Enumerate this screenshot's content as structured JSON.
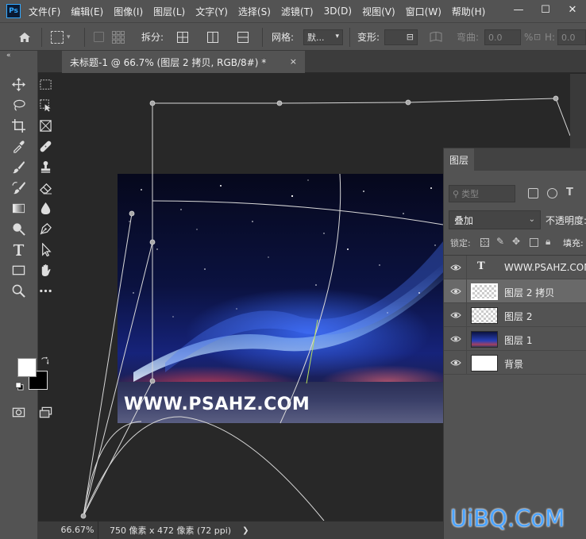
{
  "app": {
    "logo_text": "Ps"
  },
  "menu": {
    "items": [
      "文件(F)",
      "编辑(E)",
      "图像(I)",
      "图层(L)",
      "文字(Y)",
      "选择(S)",
      "滤镜(T)",
      "3D(D)",
      "视图(V)",
      "窗口(W)",
      "帮助(H)"
    ]
  },
  "window_controls": {
    "minimize": "—",
    "maximize": "☐",
    "close": "✕"
  },
  "options_bar": {
    "split_label": "拆分:",
    "grid_label": "网格:",
    "grid_value": "默...",
    "transform_label": "变形:",
    "warp_label": "弯曲:",
    "warp_value": "0.0",
    "percent": "%",
    "h_label": "H:",
    "h_value": "0.0"
  },
  "document": {
    "tab_title": "未标题-1 @ 66.7% (图层 2 拷贝, RGB/8#) *",
    "close": "×",
    "photo_watermark": "WWW.PSAHZ.COM"
  },
  "status": {
    "zoom": "66.67%",
    "info": "750 像素 x 472 像素 (72 ppi)",
    "arrow": "❯"
  },
  "layers_panel": {
    "tab": "图层",
    "search_placeholder": "类型",
    "blend_mode": "叠加",
    "opacity_label": "不透明度:",
    "lock_label": "锁定:",
    "fill_label": "填充:",
    "layers": [
      {
        "name": "WWW.PSAHZ.COM",
        "kind": "type",
        "selected": false
      },
      {
        "name": "图层 2 拷贝",
        "kind": "transparent",
        "selected": true
      },
      {
        "name": "图层 2",
        "kind": "transparent",
        "selected": false
      },
      {
        "name": "图层 1",
        "kind": "photo",
        "selected": false
      },
      {
        "name": "背景",
        "kind": "white",
        "selected": false
      }
    ],
    "type_thumb_glyph": "T"
  },
  "colors": {
    "foreground": "#ffffff",
    "background": "#000000",
    "accent": "#31a8ff",
    "watermark": "#4aa3ff"
  },
  "watermark": {
    "text": "UiBQ.CoM"
  }
}
